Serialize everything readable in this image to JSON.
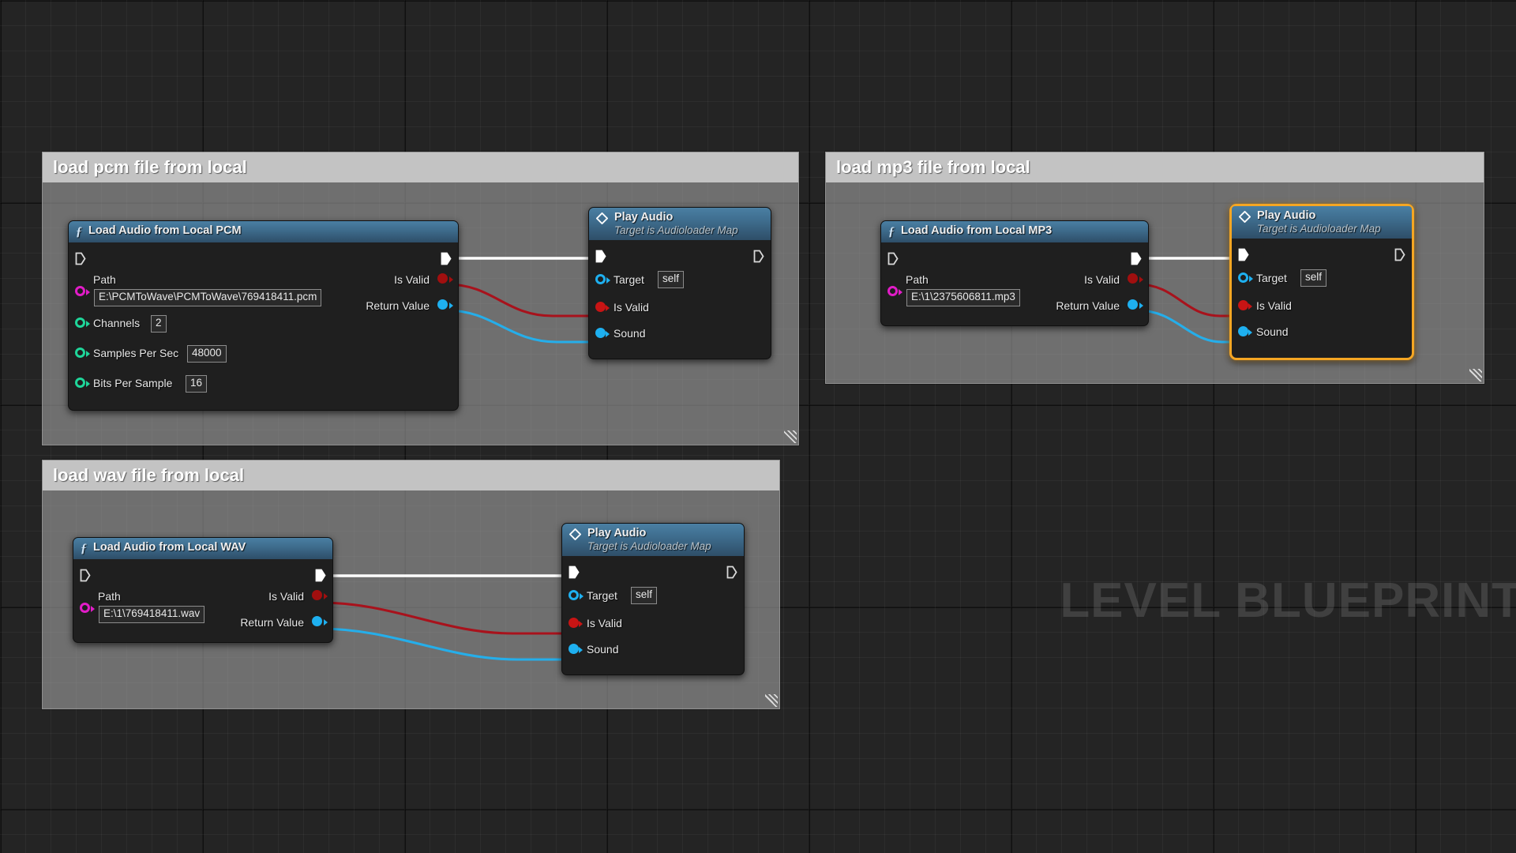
{
  "editor": {
    "watermark": "LEVEL BLUEPRINT",
    "background_color": "#242424",
    "selection_color": "#f5a623"
  },
  "comments": [
    {
      "id": "pcm",
      "title": "load pcm file from local"
    },
    {
      "id": "mp3",
      "title": "load mp3 file from local"
    },
    {
      "id": "wav",
      "title": "load wav file from local"
    }
  ],
  "nodes": {
    "load_pcm": {
      "title": "Load Audio from Local PCM",
      "icon": "function-icon",
      "inputs": [
        {
          "label": "Path",
          "value": "E:\\PCMToWave\\PCMToWave\\769418411.pcm",
          "pin": "string-pin",
          "color": "#e21cc8"
        },
        {
          "label": "Channels",
          "value": "2",
          "pin": "int-pin",
          "color": "#1fd69a"
        },
        {
          "label": "Samples Per Sec",
          "value": "48000",
          "pin": "int-pin",
          "color": "#1fd69a"
        },
        {
          "label": "Bits Per Sample",
          "value": "16",
          "pin": "int-pin",
          "color": "#1fd69a"
        }
      ],
      "outputs": [
        {
          "label": "Is Valid",
          "pin": "bool-pin",
          "color": "#a10f0f"
        },
        {
          "label": "Return Value",
          "pin": "object-pin",
          "color": "#1eb0f0"
        }
      ]
    },
    "load_mp3": {
      "title": "Load Audio from Local MP3",
      "icon": "function-icon",
      "inputs": [
        {
          "label": "Path",
          "value": "E:\\1\\2375606811.mp3",
          "pin": "string-pin",
          "color": "#e21cc8"
        }
      ],
      "outputs": [
        {
          "label": "Is Valid",
          "pin": "bool-pin",
          "color": "#a10f0f"
        },
        {
          "label": "Return Value",
          "pin": "object-pin",
          "color": "#1eb0f0"
        }
      ]
    },
    "load_wav": {
      "title": "Load Audio from Local WAV",
      "icon": "function-icon",
      "inputs": [
        {
          "label": "Path",
          "value": "E:\\1\\769418411.wav",
          "pin": "string-pin",
          "color": "#e21cc8"
        }
      ],
      "outputs": [
        {
          "label": "Is Valid",
          "pin": "bool-pin",
          "color": "#a10f0f"
        },
        {
          "label": "Return Value",
          "pin": "object-pin",
          "color": "#1eb0f0"
        }
      ]
    },
    "play_audio_pcm": {
      "title": "Play Audio",
      "subtitle": "Target is Audioloader Map",
      "icon": "diamond-icon",
      "selected": false,
      "inputs": [
        {
          "label": "Target",
          "value": "self",
          "pin": "object-pin",
          "color": "#1eb0f0"
        },
        {
          "label": "Is Valid",
          "pin": "bool-pin",
          "color": "#c81414"
        },
        {
          "label": "Sound",
          "pin": "object-pin",
          "color": "#1eb0f0"
        }
      ]
    },
    "play_audio_mp3": {
      "title": "Play Audio",
      "subtitle": "Target is Audioloader Map",
      "icon": "diamond-icon",
      "selected": true,
      "inputs": [
        {
          "label": "Target",
          "value": "self",
          "pin": "object-pin",
          "color": "#1eb0f0"
        },
        {
          "label": "Is Valid",
          "pin": "bool-pin",
          "color": "#c81414"
        },
        {
          "label": "Sound",
          "pin": "object-pin",
          "color": "#1eb0f0"
        }
      ]
    },
    "play_audio_wav": {
      "title": "Play Audio",
      "subtitle": "Target is Audioloader Map",
      "icon": "diamond-icon",
      "selected": false,
      "inputs": [
        {
          "label": "Target",
          "value": "self",
          "pin": "object-pin",
          "color": "#1eb0f0"
        },
        {
          "label": "Is Valid",
          "pin": "bool-pin",
          "color": "#c81414"
        },
        {
          "label": "Sound",
          "pin": "object-pin",
          "color": "#1eb0f0"
        }
      ]
    }
  },
  "wire_colors": {
    "exec": "#ffffff",
    "bool": "#a8121c",
    "object": "#25aeea"
  }
}
